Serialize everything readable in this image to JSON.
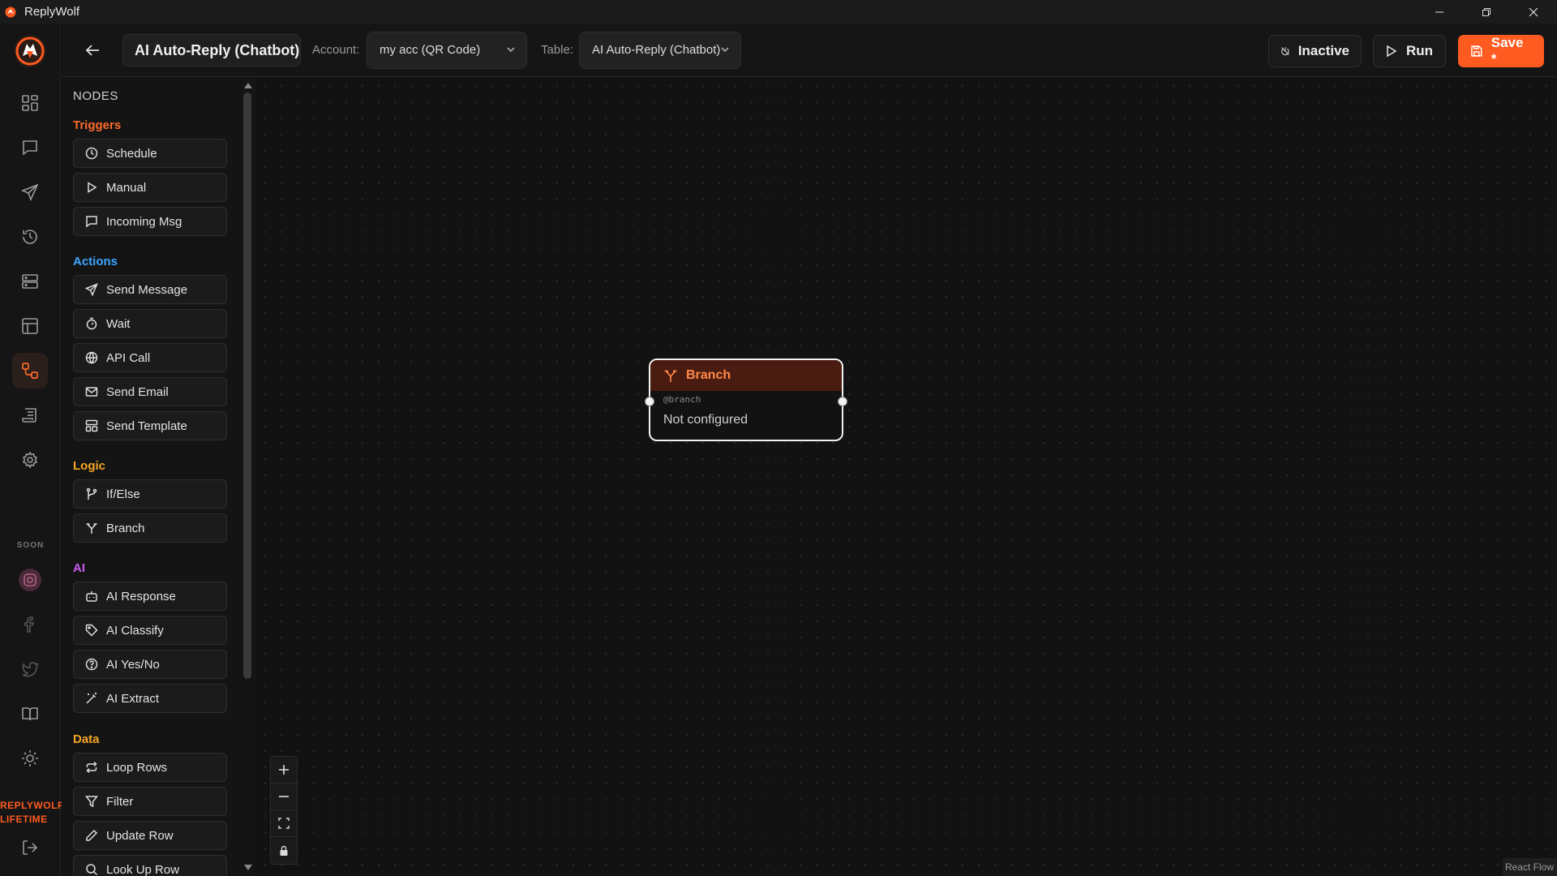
{
  "window": {
    "title": "ReplyWolf"
  },
  "rail": {
    "soon_label": "SOON",
    "brand_line1": "REPLYWOLF",
    "brand_line2": "LIFETIME",
    "accent": "#ff5a1f"
  },
  "header": {
    "workflow_name": "AI Auto-Reply (Chatbot)",
    "account_label": "Account:",
    "account_value": "my acc (QR Code)",
    "table_label": "Table:",
    "table_value": "AI Auto-Reply (Chatbot)",
    "inactive_label": "Inactive",
    "run_label": "Run",
    "save_label": "Save *"
  },
  "nodes_panel": {
    "title": "NODES",
    "sections": [
      {
        "title": "Triggers",
        "color": "#ff6a2a",
        "items": [
          "Schedule",
          "Manual",
          "Incoming Msg"
        ]
      },
      {
        "title": "Actions",
        "color": "#3ea6ff",
        "items": [
          "Send Message",
          "Wait",
          "API Call",
          "Send Email",
          "Send Template"
        ]
      },
      {
        "title": "Logic",
        "color": "#f5a623",
        "items": [
          "If/Else",
          "Branch"
        ]
      },
      {
        "title": "AI",
        "color": "#c95cf0",
        "items": [
          "AI Response",
          "AI Classify",
          "AI Yes/No",
          "AI Extract"
        ]
      },
      {
        "title": "Data",
        "color": "#f5a623",
        "items": [
          "Loop Rows",
          "Filter",
          "Update Row",
          "Look Up Row"
        ]
      }
    ]
  },
  "canvas": {
    "node": {
      "title": "Branch",
      "id": "@branch",
      "status": "Not configured"
    },
    "attribution": "React Flow"
  }
}
